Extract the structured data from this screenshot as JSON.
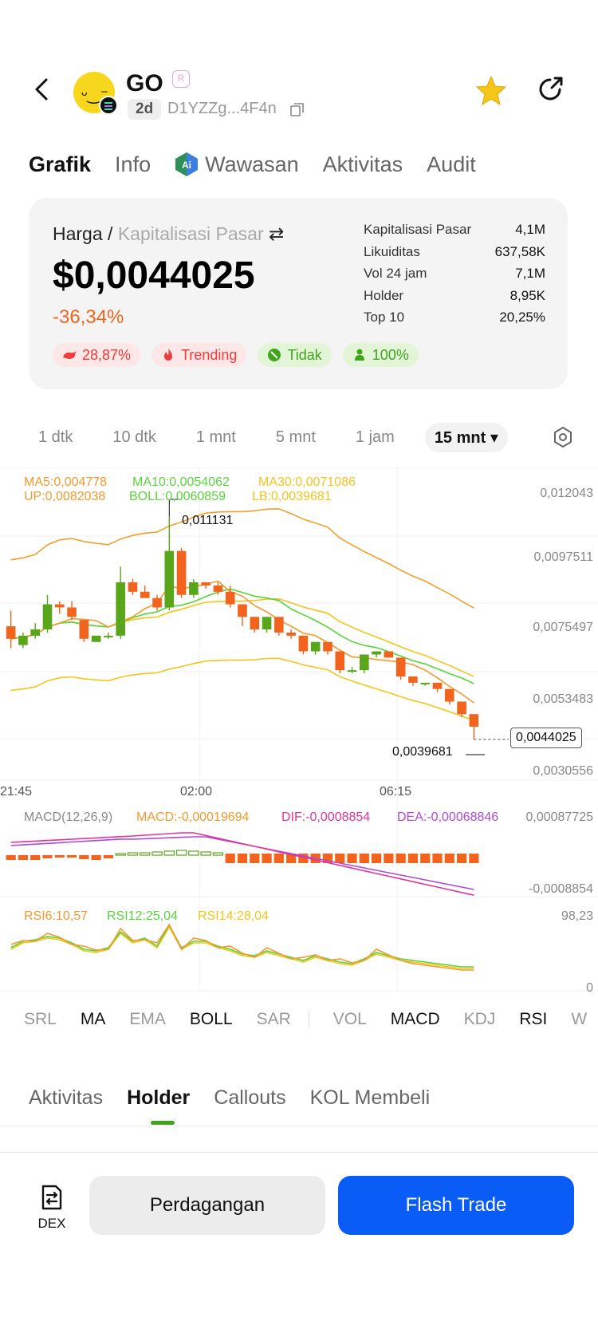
{
  "header": {
    "token_name": "GO",
    "age": "2d",
    "address": "D1YZZg...4F4n",
    "icons": [
      "back-arrow-icon",
      "token-avatar",
      "solana-chain-icon",
      "verified-badge-icon",
      "copy-icon",
      "star-icon",
      "share-icon"
    ],
    "accent_star": "#f5c518"
  },
  "tabs": [
    {
      "label": "Grafik",
      "active": true
    },
    {
      "label": "Info",
      "active": false
    },
    {
      "label": "Wawasan",
      "active": false
    },
    {
      "label": "Aktivitas",
      "active": false
    },
    {
      "label": "Audit",
      "active": false
    }
  ],
  "price": {
    "label_primary": "Harga /",
    "label_secondary": "Kapitalisasi Pasar",
    "swap_glyph": "⇄",
    "value": "$0,0044025",
    "change": "-36,34%",
    "change_color": "#f2641e",
    "chips": [
      {
        "icon": "whale-icon",
        "text": "28,87%",
        "color": "red"
      },
      {
        "icon": "fire-icon",
        "text": "Trending",
        "color": "red"
      },
      {
        "icon": "no-sign-icon",
        "text": "Tidak",
        "color": "green"
      },
      {
        "icon": "person-icon",
        "text": "100%",
        "color": "green"
      }
    ],
    "stats": [
      {
        "label": "Kapitalisasi Pasar",
        "value": "4,1M"
      },
      {
        "label": "Likuiditas",
        "value": "637,58K"
      },
      {
        "label": "Vol 24 jam",
        "value": "7,1M"
      },
      {
        "label": "Holder",
        "value": "8,95K"
      },
      {
        "label": "Top 10",
        "value": "20,25%"
      }
    ]
  },
  "intervals": [
    {
      "label": "1 dtk",
      "active": false
    },
    {
      "label": "10 dtk",
      "active": false
    },
    {
      "label": "1 mnt",
      "active": false
    },
    {
      "label": "5 mnt",
      "active": false
    },
    {
      "label": "1 jam",
      "active": false
    },
    {
      "label": "15 mnt ▾",
      "active": true
    }
  ],
  "chart_data": {
    "type": "candlestick",
    "legend": {
      "ma5": "MA5:0,004778",
      "ma10": "MA10:0,0054062",
      "ma30": "MA30:0,0071086",
      "up": "UP:0,0082038",
      "boll": "BOLL:0,0060859",
      "lb": "LB:0,0039681"
    },
    "y_ticks": [
      "0,012043",
      "0,0097511",
      "0,0075497",
      "0,0053483",
      "0,0030556"
    ],
    "x_ticks": [
      "21:45",
      "02:00",
      "06:15"
    ],
    "high_label": "0,011131",
    "low_label": "0,0039681",
    "last_price": "0,0044025",
    "candles": [
      [
        0.0076,
        0.0081,
        0.0072,
        0.0069
      ],
      [
        0.007,
        0.0074,
        0.0073,
        0.0069
      ],
      [
        0.0073,
        0.0077,
        0.0075,
        0.0072
      ],
      [
        0.0075,
        0.0086,
        0.0083,
        0.0074
      ],
      [
        0.0083,
        0.0084,
        0.0082,
        0.008
      ],
      [
        0.0082,
        0.0084,
        0.0079,
        0.0078
      ],
      [
        0.0078,
        0.0078,
        0.0072,
        0.0071
      ],
      [
        0.0071,
        0.0073,
        0.0073,
        0.0071
      ],
      [
        0.0073,
        0.0074,
        0.0073,
        0.0072
      ],
      [
        0.0073,
        0.0095,
        0.009,
        0.0072
      ],
      [
        0.009,
        0.0091,
        0.0087,
        0.0086
      ],
      [
        0.0087,
        0.0089,
        0.0085,
        0.0085
      ],
      [
        0.0085,
        0.0086,
        0.0082,
        0.0081
      ],
      [
        0.0082,
        0.0111,
        0.01,
        0.0081
      ],
      [
        0.01,
        0.0101,
        0.0086,
        0.0085
      ],
      [
        0.0086,
        0.0091,
        0.009,
        0.0085
      ],
      [
        0.009,
        0.009,
        0.0089,
        0.0088
      ],
      [
        0.0089,
        0.009,
        0.0087,
        0.0086
      ],
      [
        0.0087,
        0.0089,
        0.0083,
        0.0082
      ],
      [
        0.0083,
        0.0083,
        0.0079,
        0.0076
      ],
      [
        0.0079,
        0.0079,
        0.0075,
        0.0074
      ],
      [
        0.0075,
        0.0079,
        0.0079,
        0.0074
      ],
      [
        0.0079,
        0.0079,
        0.0074,
        0.0073
      ],
      [
        0.0074,
        0.0075,
        0.0073,
        0.0072
      ],
      [
        0.0073,
        0.0073,
        0.0068,
        0.0067
      ],
      [
        0.0068,
        0.0071,
        0.0071,
        0.0067
      ],
      [
        0.0071,
        0.0071,
        0.0068,
        0.0067
      ],
      [
        0.0068,
        0.0068,
        0.0062,
        0.0061
      ],
      [
        0.0062,
        0.0063,
        0.0062,
        0.0061
      ],
      [
        0.0062,
        0.0067,
        0.0067,
        0.0061
      ],
      [
        0.0067,
        0.0068,
        0.0068,
        0.0066
      ],
      [
        0.0068,
        0.0068,
        0.0066,
        0.0066
      ],
      [
        0.0066,
        0.0066,
        0.006,
        0.0059
      ],
      [
        0.006,
        0.006,
        0.0058,
        0.0057
      ],
      [
        0.0058,
        0.0058,
        0.0058,
        0.0057
      ],
      [
        0.0058,
        0.0058,
        0.0056,
        0.0055
      ],
      [
        0.0056,
        0.0056,
        0.0052,
        0.0051
      ],
      [
        0.0052,
        0.0052,
        0.0048,
        0.0047
      ],
      [
        0.0048,
        0.0048,
        0.0044,
        0.004
      ]
    ],
    "macd_legend": {
      "title": "MACD(12,26,9)",
      "macd": "MACD:-0,00019694",
      "dif": "DIF:-0,0008854",
      "dea": "DEA:-0,00068846"
    },
    "macd_ticks": [
      "0,00087725",
      "-0,0008854"
    ],
    "rsi_legend": {
      "rsi6": "RSI6:10,57",
      "rsi12": "RSI12:25,04",
      "rsi14": "RSI14:28,04"
    },
    "rsi_ticks": [
      "98,23",
      "0"
    ],
    "colors": {
      "up": "#5aa61b",
      "down": "#f2641e",
      "ma5": "#f29a2e",
      "ma10": "#5ad43c",
      "ma30": "#f3c51a",
      "boll_band": "#f0a030",
      "dif": "#e0349a",
      "dea": "#b04ad4"
    }
  },
  "indicators": [
    {
      "label": "SRL",
      "on": false
    },
    {
      "label": "MA",
      "on": true
    },
    {
      "label": "EMA",
      "on": false
    },
    {
      "label": "BOLL",
      "on": true
    },
    {
      "label": "SAR",
      "on": false
    },
    {
      "label": "VOL",
      "on": false
    },
    {
      "label": "MACD",
      "on": true
    },
    {
      "label": "KDJ",
      "on": false
    },
    {
      "label": "RSI",
      "on": true
    },
    {
      "label": "W",
      "on": false
    }
  ],
  "bottom_tabs": [
    {
      "label": "Aktivitas",
      "active": false
    },
    {
      "label": "Holder",
      "active": true
    },
    {
      "label": "Callouts",
      "active": false
    },
    {
      "label": "KOL Membeli",
      "active": false
    }
  ],
  "bottom_bar": {
    "dex_label": "DEX",
    "trade_label": "Perdagangan",
    "flash_label": "Flash Trade",
    "flash_color": "#0a5cf7"
  }
}
